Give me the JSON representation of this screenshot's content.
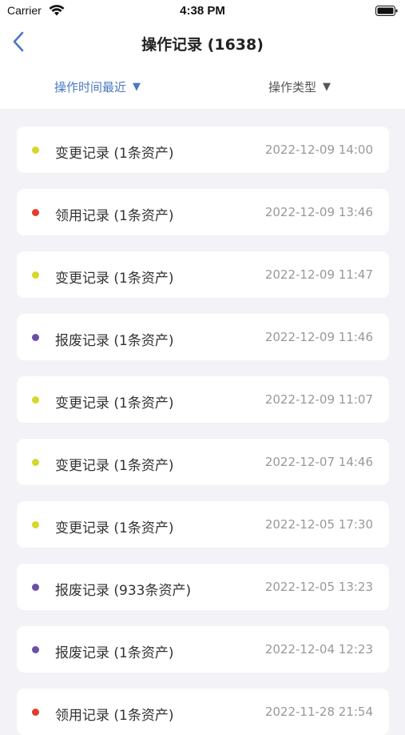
{
  "status_bar": {
    "carrier": "Carrier",
    "time": "4:38 PM"
  },
  "nav": {
    "title": "操作记录 (1638)"
  },
  "filters": [
    {
      "label": "操作时间最近",
      "caret": "▼",
      "active": true
    },
    {
      "label": "操作类型",
      "caret": "▼",
      "active": false
    }
  ],
  "colors": {
    "change": "#d4d82a",
    "receive": "#e53b2d",
    "scrap": "#6b4fa8",
    "accent": "#4a78c0"
  },
  "records": [
    {
      "title": "变更记录 (1条资产)",
      "time": "2022-12-09 14:00",
      "type": "change"
    },
    {
      "title": "领用记录 (1条资产)",
      "time": "2022-12-09 13:46",
      "type": "receive"
    },
    {
      "title": "变更记录 (1条资产)",
      "time": "2022-12-09 11:47",
      "type": "change"
    },
    {
      "title": "报废记录 (1条资产)",
      "time": "2022-12-09 11:46",
      "type": "scrap"
    },
    {
      "title": "变更记录 (1条资产)",
      "time": "2022-12-09 11:07",
      "type": "change"
    },
    {
      "title": "变更记录 (1条资产)",
      "time": "2022-12-07 14:46",
      "type": "change"
    },
    {
      "title": "变更记录 (1条资产)",
      "time": "2022-12-05 17:30",
      "type": "change"
    },
    {
      "title": "报废记录 (933条资产)",
      "time": "2022-12-05 13:23",
      "type": "scrap"
    },
    {
      "title": "报废记录 (1条资产)",
      "time": "2022-12-04 12:23",
      "type": "scrap"
    },
    {
      "title": "领用记录 (1条资产)",
      "time": "2022-11-28 21:54",
      "type": "receive"
    }
  ]
}
